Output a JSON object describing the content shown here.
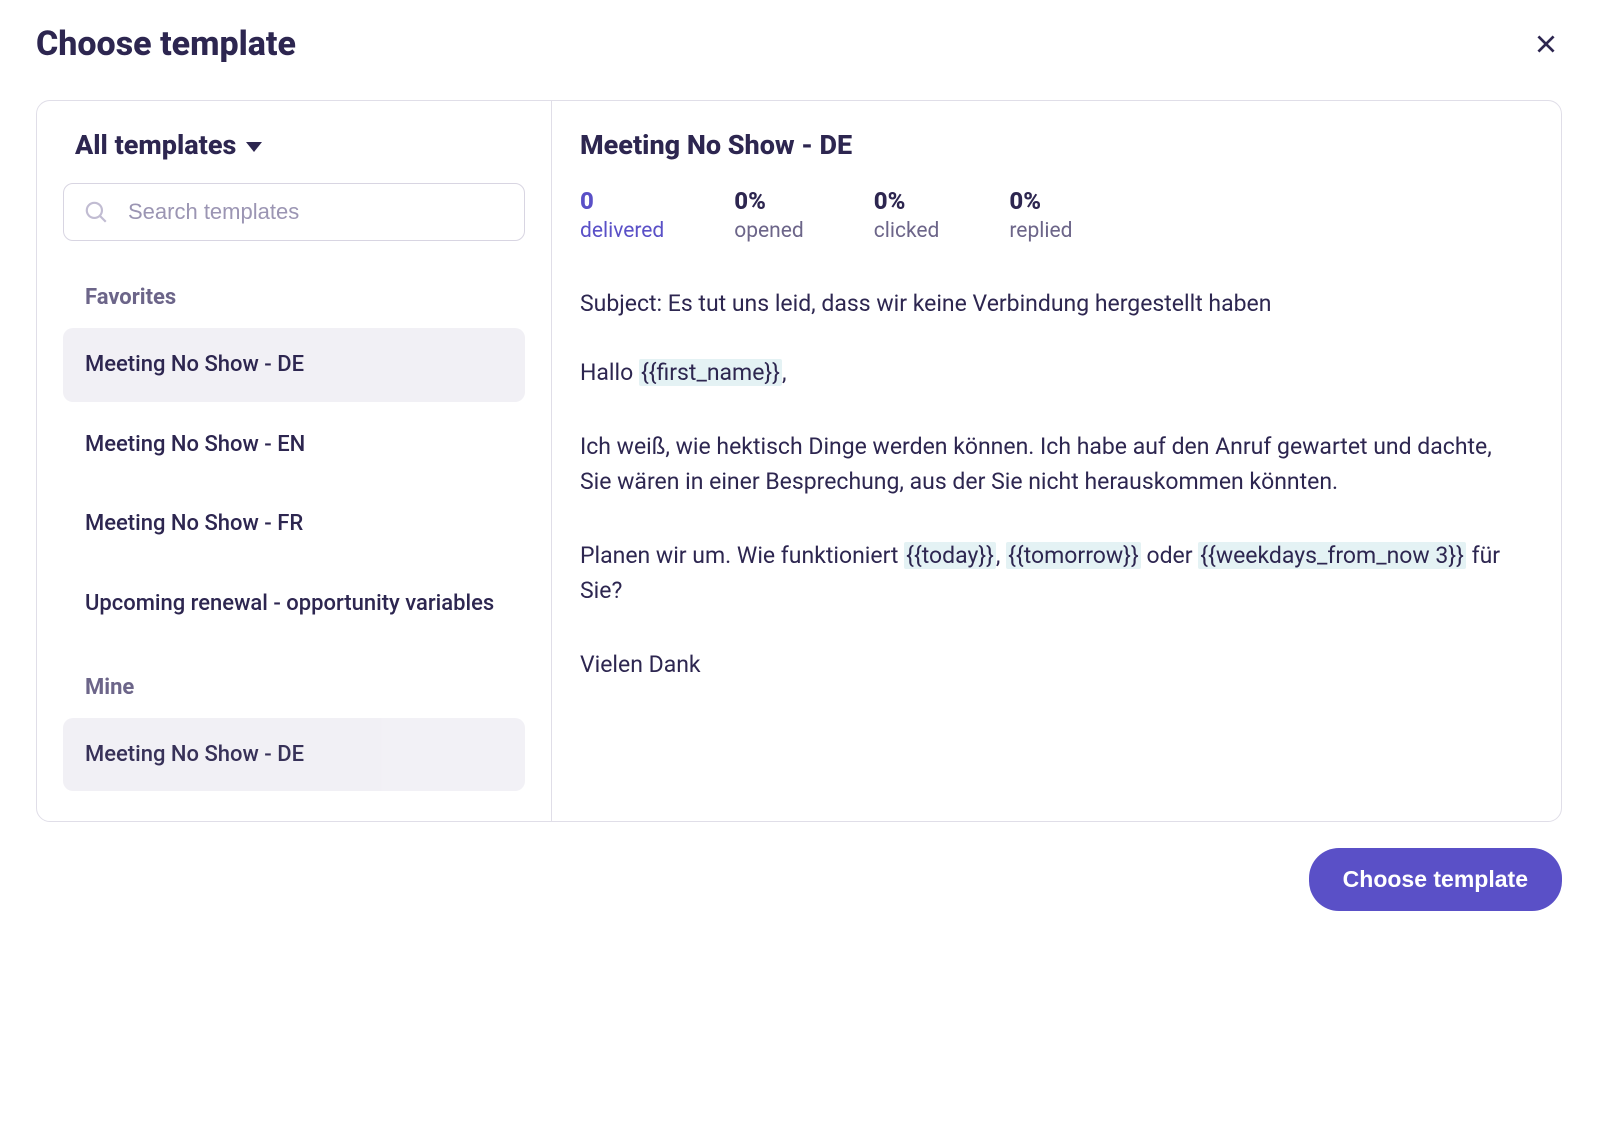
{
  "header": {
    "title": "Choose template"
  },
  "sidebar": {
    "filter_label": "All templates",
    "search_placeholder": "Search templates",
    "sections": [
      {
        "label": "Favorites",
        "items": [
          {
            "label": "Meeting No Show - DE",
            "selected": true
          },
          {
            "label": "Meeting No Show - EN",
            "selected": false
          },
          {
            "label": "Meeting No Show - FR",
            "selected": false
          },
          {
            "label": "Upcoming renewal - opportunity variables",
            "selected": false
          }
        ]
      },
      {
        "label": "Mine",
        "items": [
          {
            "label": "Meeting No Show - DE",
            "selected": false
          }
        ]
      }
    ]
  },
  "preview": {
    "title": "Meeting No Show - DE",
    "stats": {
      "delivered": {
        "value": "0",
        "label": "delivered"
      },
      "opened": {
        "value": "0%",
        "label": "opened"
      },
      "clicked": {
        "value": "0%",
        "label": "clicked"
      },
      "replied": {
        "value": "0%",
        "label": "replied"
      }
    },
    "subject_line": "Subject: Es tut uns leid, dass wir keine Verbindung hergestellt haben",
    "greeting_pre": "Hallo ",
    "greeting_token": "{{first_name}}",
    "greeting_post": ",",
    "para1": "Ich weiß, wie hektisch Dinge werden können. Ich habe auf den Anruf gewartet und dachte, Sie wären in einer Besprechung, aus der Sie nicht herauskommen könnten.",
    "para2_pre": "Planen wir um. Wie funktioniert ",
    "para2_tok1": "{{today}}",
    "para2_mid1": ", ",
    "para2_tok2": "{{tomorrow}}",
    "para2_mid2": " oder ",
    "para2_tok3": "{{weekdays_from_now 3}}",
    "para2_post": " für Sie?",
    "closing": "Vielen Dank"
  },
  "footer": {
    "choose_label": "Choose template"
  }
}
